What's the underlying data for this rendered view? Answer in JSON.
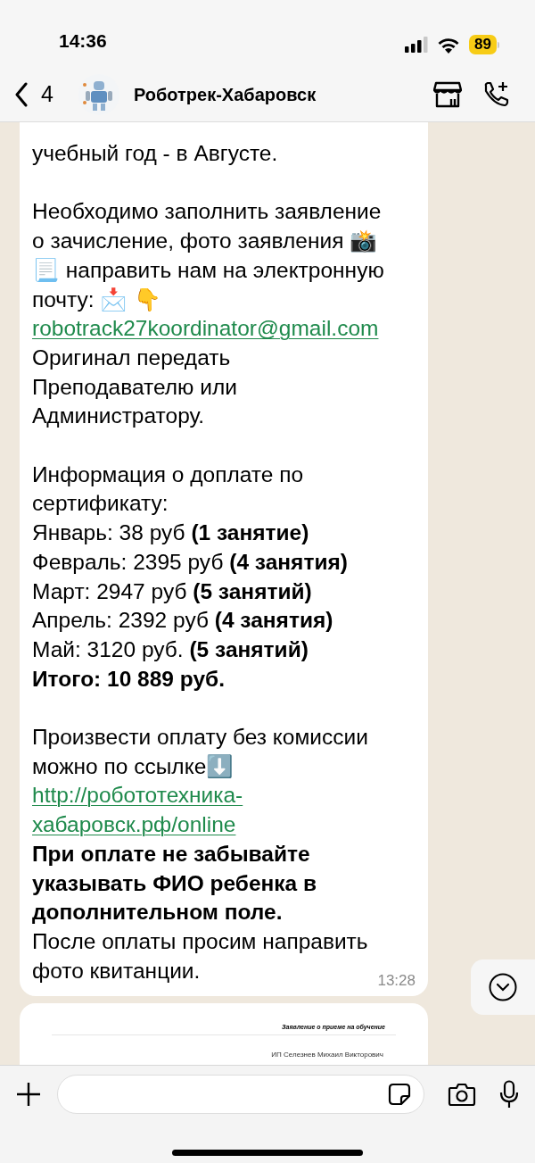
{
  "status_bar": {
    "time": "14:36",
    "battery": "89"
  },
  "header": {
    "back_count": "4",
    "title": "Роботрек-Хабаровск"
  },
  "messages": [
    {
      "kind": "text",
      "time": "13:28",
      "lines": [
        {
          "kind": "text",
          "text": "учебный год - в Августе."
        },
        {
          "kind": "gap"
        },
        {
          "kind": "text",
          "text": "Необходимо заполнить заявление"
        },
        {
          "kind": "text",
          "text": "о зачисление, фото заявления 📸"
        },
        {
          "kind": "text",
          "text": "📃 направить нам на электронную"
        },
        {
          "kind": "text",
          "text": "почту: 📩 👇"
        },
        {
          "kind": "link",
          "text": "robotrack27koordinator@gmail.com"
        },
        {
          "kind": "text",
          "text": "Оригинал передать"
        },
        {
          "kind": "text",
          "text": "Преподавателю или"
        },
        {
          "kind": "text",
          "text": "Администратору."
        },
        {
          "kind": "gap"
        },
        {
          "kind": "text",
          "text": "Информация о доплате по"
        },
        {
          "kind": "text",
          "text": "сертификату:"
        },
        {
          "kind": "text",
          "text": "Январь: 38 руб **(1 занятие)**"
        },
        {
          "kind": "text",
          "text": "Февраль: 2395 руб  **(4 занятия)**"
        },
        {
          "kind": "text",
          "text": "Март: 2947 руб  **(5 занятий)**"
        },
        {
          "kind": "text",
          "text": "Апрель: 2392 руб  **(4 занятия)**"
        },
        {
          "kind": "text",
          "text": "Май: 3120 руб.  **(5 занятий)**"
        },
        {
          "kind": "bold",
          "text": "Итого: 10 889 руб."
        },
        {
          "kind": "gap"
        },
        {
          "kind": "text",
          "text": "Произвести оплату без комиссии"
        },
        {
          "kind": "text",
          "text": "можно по ссылке⬇️"
        },
        {
          "kind": "link",
          "text": "http://робототехника-"
        },
        {
          "kind": "link",
          "text": "хабаровск.рф/online"
        },
        {
          "kind": "bold",
          "text": "При оплате не забывайте"
        },
        {
          "kind": "bold",
          "text": "указывать ФИО ребенка в"
        },
        {
          "kind": "bold",
          "text": "дополнительном поле."
        },
        {
          "kind": "text",
          "text": "После оплаты просим направить"
        },
        {
          "kind": "text",
          "text": "фото квитанции."
        }
      ]
    },
    {
      "kind": "document",
      "title": "Заявление о приеме на обучение",
      "lines": [
        "ИП Селезнев Михаил Викторович"
      ]
    }
  ]
}
